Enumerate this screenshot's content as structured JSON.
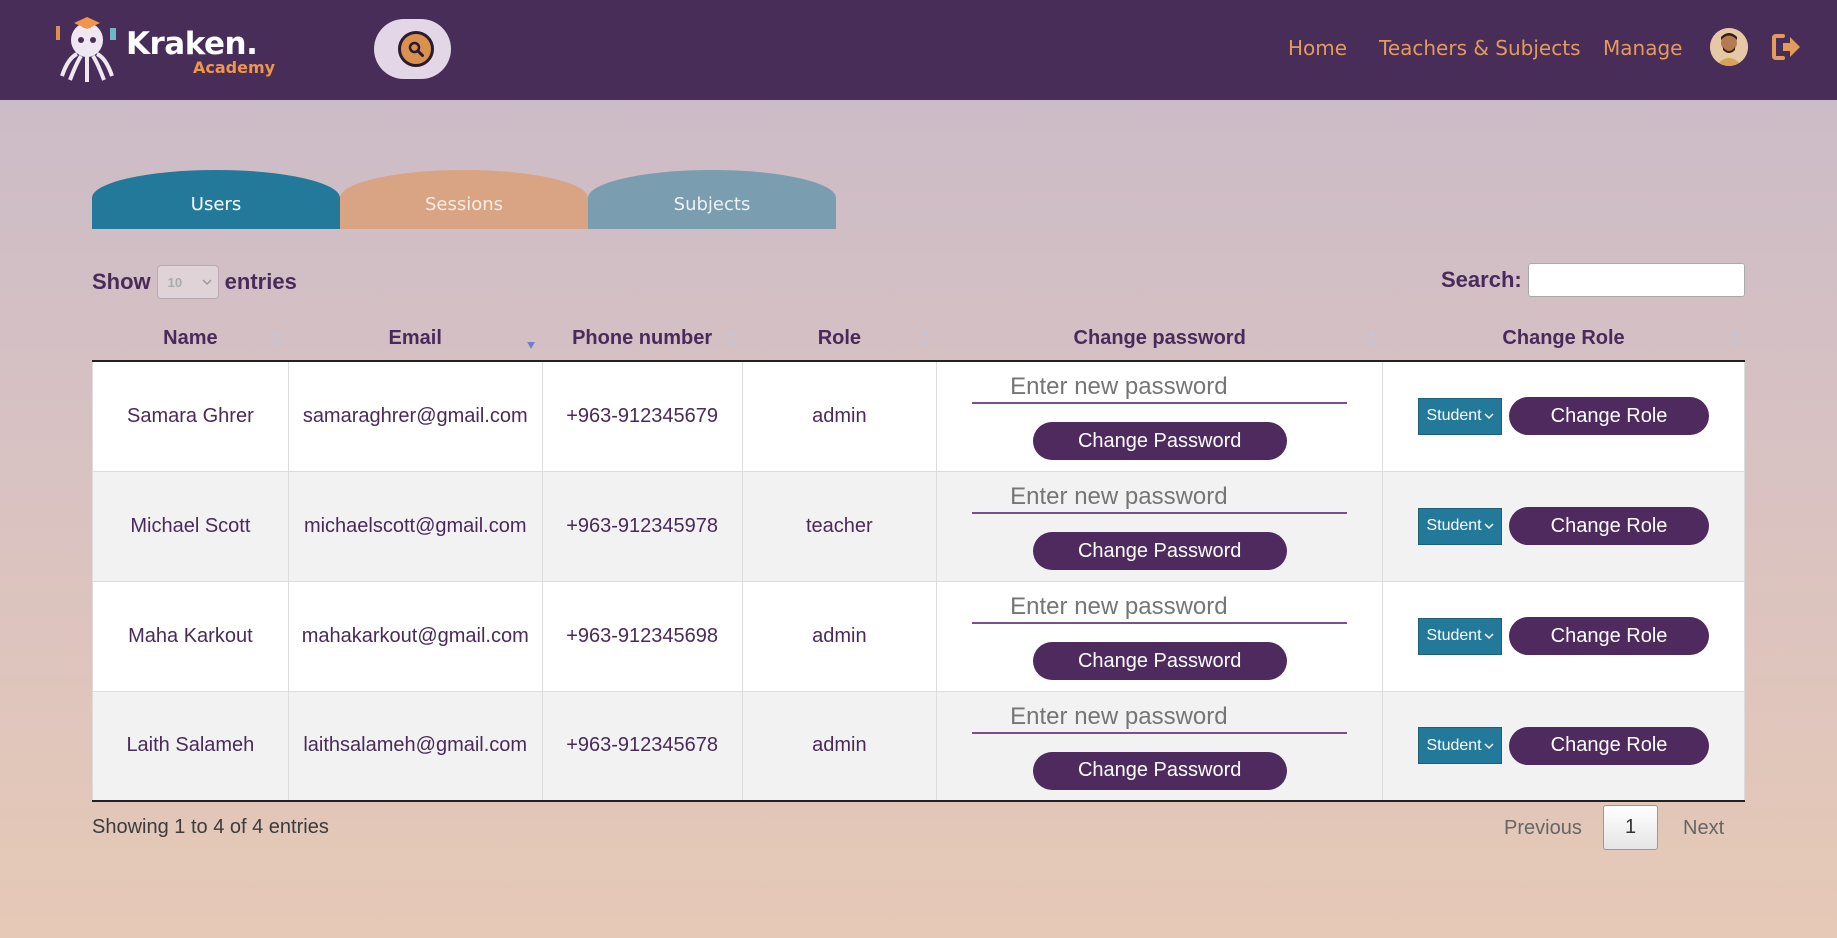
{
  "header": {
    "logo_title": "Kraken.",
    "logo_subtitle": "Academy",
    "nav": {
      "home": "Home",
      "teachers": "Teachers & Subjects",
      "manage": "Manage"
    },
    "icons": {
      "search": "search-icon",
      "logout": "logout-icon"
    },
    "colors": {
      "bar": "#482d58",
      "link": "#e49a5a"
    }
  },
  "tabs": [
    {
      "label": "Users",
      "color": "#23799a",
      "active": true
    },
    {
      "label": "Sessions",
      "color": "#d8a483",
      "active": false
    },
    {
      "label": "Subjects",
      "color": "#7a9db0",
      "active": false
    }
  ],
  "controls": {
    "show_label": "Show",
    "entries_label": "entries",
    "length_value": "10",
    "search_label": "Search:",
    "search_value": ""
  },
  "table": {
    "columns": [
      "Name",
      "Email",
      "Phone number",
      "Role",
      "Change password",
      "Change Role"
    ],
    "sorted_column": "Email",
    "password_placeholder": "Enter new password",
    "password_button": "Change Password",
    "role_button": "Change Role",
    "rows": [
      {
        "name": "Samara Ghrer",
        "email": "samaraghrer@gmail.com",
        "phone": "+963-912345679",
        "role": "admin",
        "role_select": "Student"
      },
      {
        "name": "Michael Scott",
        "email": "michaelscott@gmail.com",
        "phone": "+963-912345978",
        "role": "teacher",
        "role_select": "Student"
      },
      {
        "name": "Maha Karkout",
        "email": "mahakarkout@gmail.com",
        "phone": "+963-912345698",
        "role": "admin",
        "role_select": "Student"
      },
      {
        "name": "Laith Salameh",
        "email": "laithsalameh@gmail.com",
        "phone": "+963-912345678",
        "role": "admin",
        "role_select": "Student"
      }
    ]
  },
  "footer": {
    "info": "Showing 1 to 4 of 4 entries",
    "previous": "Previous",
    "page": "1",
    "next": "Next"
  }
}
